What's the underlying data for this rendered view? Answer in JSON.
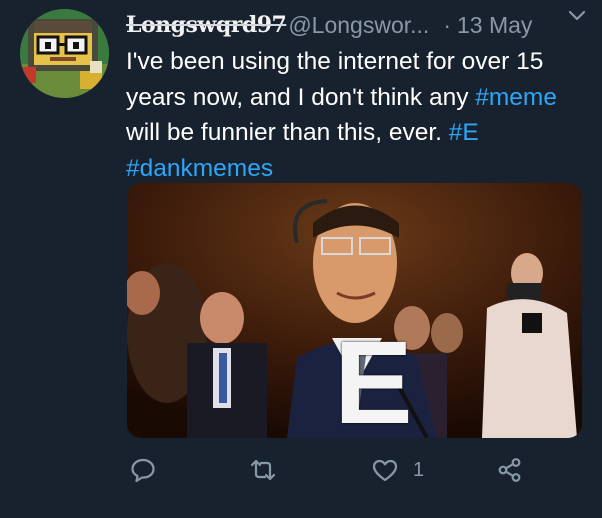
{
  "tweet": {
    "display_name": "Longswqrd97",
    "handle": "@Longswor...",
    "separator": "·",
    "date": "13 May",
    "text_parts": {
      "p1": "I've been using the internet for over 15 years now, and I don't think any ",
      "tag1": "#meme",
      "p2": " will be funnier than this, ever. ",
      "tag2": "#E",
      "p3": " ",
      "tag3": "#dankmemes"
    },
    "media_letter": "E",
    "like_count": "1"
  },
  "icons": {
    "caret": "chevron-down-icon",
    "reply": "reply-icon",
    "retweet": "retweet-icon",
    "like": "heart-icon",
    "share": "share-icon"
  },
  "colors": {
    "background": "#18222f",
    "text": "#ffffff",
    "muted": "#8899a6",
    "hashtag": "#2ea5f5"
  }
}
